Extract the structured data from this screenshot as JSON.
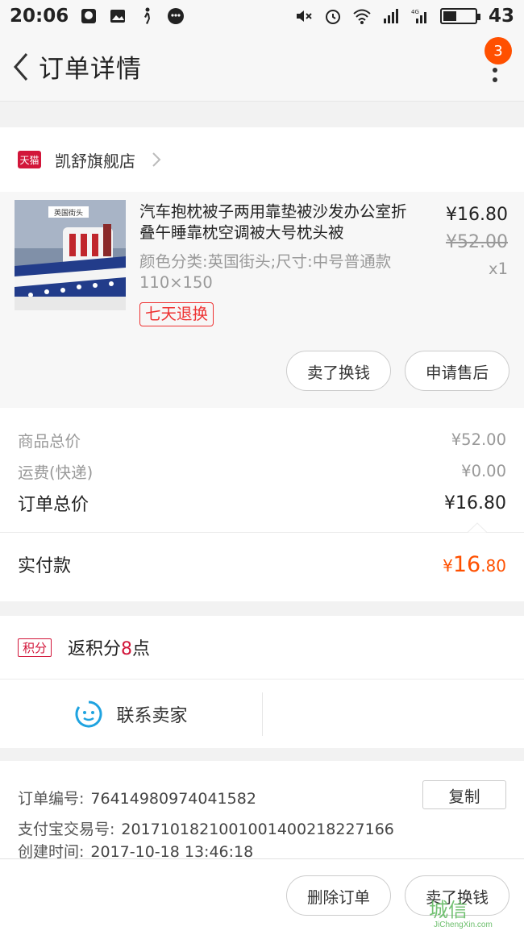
{
  "status_bar": {
    "time": "20:06",
    "battery_level": "43",
    "battery_fill": 0.43,
    "network_label": "4G"
  },
  "nav": {
    "title": "订单详情",
    "badge_count": "3"
  },
  "shop": {
    "tag": "天猫",
    "name": "凯舒旗舰店"
  },
  "item": {
    "image_label": "英国街头",
    "title": "汽车抱枕被子两用靠垫被沙发办公室折叠午睡靠枕空调被大号枕头被",
    "sku": "颜色分类:英国街头;尺寸:中号普通款110×150",
    "return_tag": "七天退换",
    "price_now": "¥16.80",
    "price_old": "¥52.00",
    "quantity": "x1",
    "sell_label": "卖了换钱",
    "service_label": "申请售后"
  },
  "prices": {
    "goods_total_label": "商品总价",
    "goods_total_value": "¥52.00",
    "shipping_label": "运费(快递)",
    "shipping_value": "¥0.00",
    "order_total_label": "订单总价",
    "order_total_value": "¥16.80",
    "paid_label": "实付款",
    "paid_currency": "¥",
    "paid_int": "16",
    "paid_dec": ".80"
  },
  "points": {
    "tag": "积分",
    "text_prefix": "返积分",
    "count": "8",
    "text_suffix": "点"
  },
  "contact": {
    "label": "联系卖家"
  },
  "order_info": {
    "order_no_label": "订单编号:",
    "order_no_value": "76414980974041582",
    "copy_label": "复制",
    "alipay_label": "支付宝交易号:",
    "alipay_value": "2017101821001001400218227166",
    "created_label": "创建时间:",
    "created_value": "2017-10-18 13:46:18"
  },
  "bottom_bar": {
    "delete_label": "删除订单",
    "sell_label": "卖了换钱"
  },
  "watermark": {
    "logo_text": "城信",
    "url": "JiChengXin.com"
  },
  "colors": {
    "accent_orange": "#ff5000",
    "tmall_red": "#d2163a",
    "return_red": "#ee3333"
  }
}
